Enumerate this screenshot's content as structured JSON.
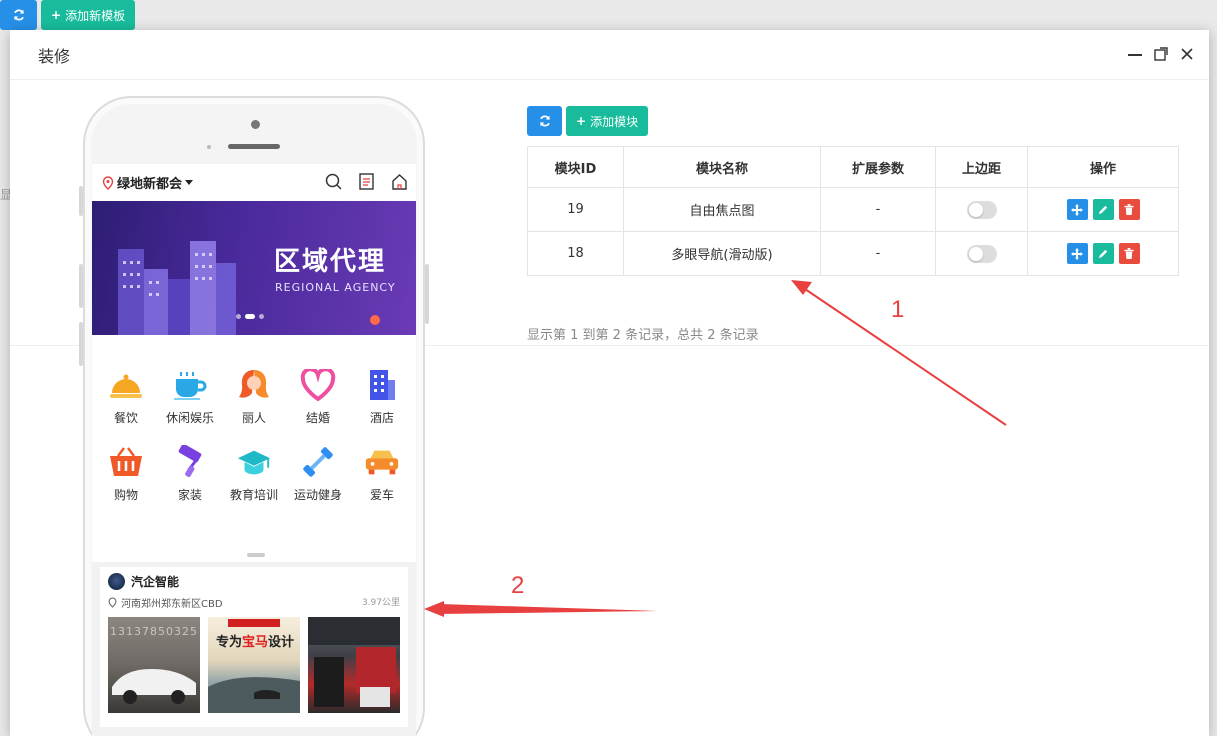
{
  "background": {
    "refresh_icon": "refresh-icon",
    "add_template_label": "添加新模板",
    "side_text": "显"
  },
  "modal": {
    "title": "装修",
    "controls": [
      "minimize-icon",
      "maximize-icon",
      "close-icon"
    ]
  },
  "phone": {
    "location": "绿地新都会",
    "top_icons": [
      "search-icon",
      "list-icon",
      "home-icon"
    ],
    "banner": {
      "title": "区域代理",
      "subtitle": "REGIONAL AGENCY"
    },
    "categories": [
      {
        "label": "餐饮",
        "icon": "dining-bell-icon",
        "color": "#f5a623"
      },
      {
        "label": "休闲娱乐",
        "icon": "coffee-cup-icon",
        "color": "#2aa8e6"
      },
      {
        "label": "丽人",
        "icon": "beauty-woman-icon",
        "color": "#f05a28"
      },
      {
        "label": "结婚",
        "icon": "heart-icon",
        "color": "#ef4fa0"
      },
      {
        "label": "酒店",
        "icon": "hotel-building-icon",
        "color": "#4355e8"
      },
      {
        "label": "购物",
        "icon": "shopping-basket-icon",
        "color": "#f05a28"
      },
      {
        "label": "家装",
        "icon": "paint-roller-icon",
        "color": "#7a3fe0"
      },
      {
        "label": "教育培训",
        "icon": "graduation-cap-icon",
        "color": "#1fb8c8"
      },
      {
        "label": "运动健身",
        "icon": "dumbbell-icon",
        "color": "#2f8ff0"
      },
      {
        "label": "爱车",
        "icon": "car-icon",
        "color": "#f5a623"
      }
    ],
    "shop": {
      "name": "汽企智能",
      "address": "河南郑州郑东新区CBD",
      "distance": "3.97公里",
      "photo1_text": "13137850325",
      "photo2_text_prefix": "专为",
      "photo2_text_highlight": "宝马",
      "photo2_text_suffix": "设计"
    }
  },
  "module_panel": {
    "add_module_label": "添加模块",
    "columns": [
      "模块ID",
      "模块名称",
      "扩展参数",
      "上边距",
      "操作"
    ],
    "rows": [
      {
        "id": "19",
        "name": "自由焦点图",
        "params": "-",
        "margin_top_on": false
      },
      {
        "id": "18",
        "name": "多眼导航(滑动版)",
        "params": "-",
        "margin_top_on": false
      }
    ],
    "summary": "显示第 1 到第 2 条记录，总共 2 条记录"
  },
  "annotations": {
    "label_1": "1",
    "label_2": "2",
    "arrow_color": "#e84040"
  }
}
